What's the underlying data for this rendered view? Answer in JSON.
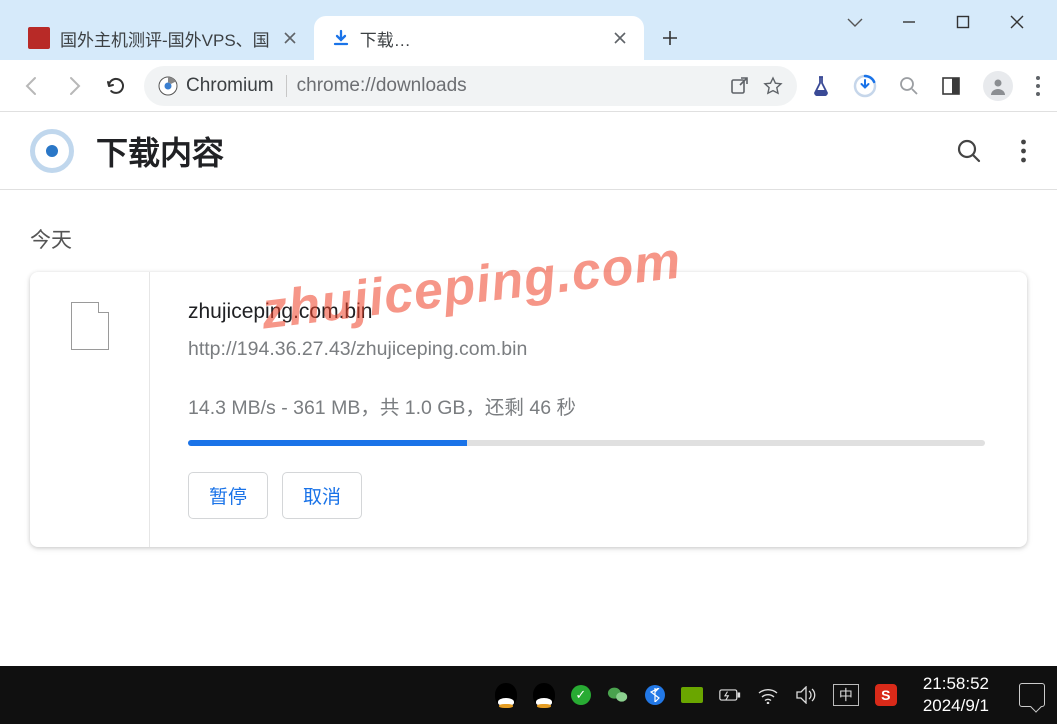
{
  "window": {
    "tabs": [
      {
        "title": "国外主机测评-国外VPS、国",
        "active": false
      },
      {
        "title": "下载内容",
        "active": true
      }
    ]
  },
  "toolbar": {
    "chip_label": "Chromium",
    "url": "chrome://downloads"
  },
  "page": {
    "title": "下载内容",
    "section_today": "今天"
  },
  "download": {
    "filename": "zhujiceping.com.bin",
    "source_url": "http://194.36.27.43/zhujiceping.com.bin",
    "status_text": "14.3 MB/s - 361 MB，共 1.0 GB，还剩 46 秒",
    "progress_percent": 35,
    "pause_label": "暂停",
    "cancel_label": "取消"
  },
  "watermark": "zhujiceping.com",
  "tray": {
    "ime": "中",
    "sogou": "S",
    "time": "21:58:52",
    "date": "2024/9/1"
  }
}
